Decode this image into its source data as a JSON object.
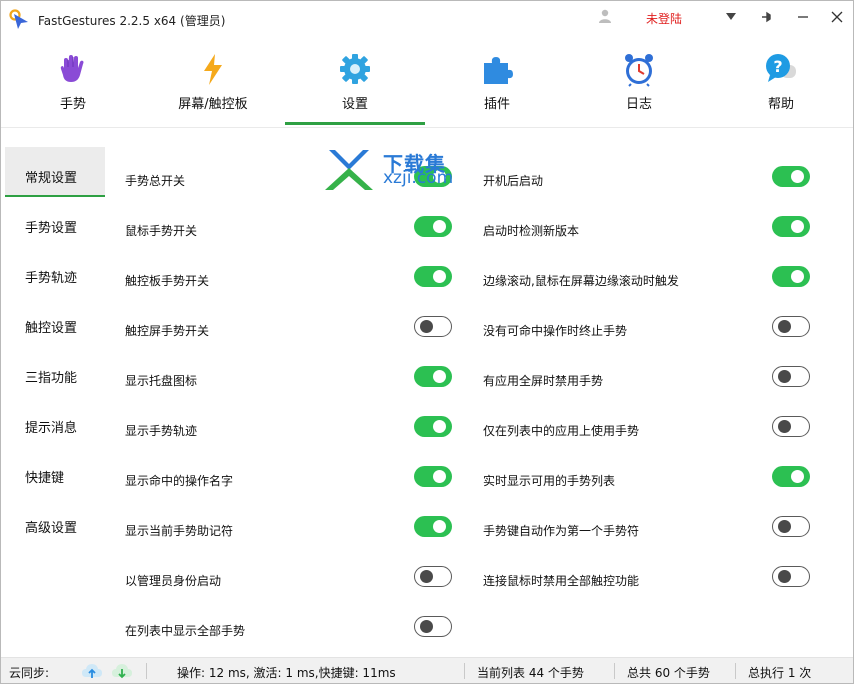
{
  "window": {
    "title": "FastGestures 2.2.5 x64  (管理员)",
    "login_status": "未登陆",
    "accent_color": "#2cc052",
    "login_color": "#e0201f"
  },
  "tabs": [
    {
      "label": "手势",
      "icon": "hand-icon",
      "active": false
    },
    {
      "label": "屏幕/触控板",
      "icon": "lightning-icon",
      "active": false
    },
    {
      "label": "设置",
      "icon": "gear-icon",
      "active": true
    },
    {
      "label": "插件",
      "icon": "puzzle-icon",
      "active": false
    },
    {
      "label": "日志",
      "icon": "alarm-clock-icon",
      "active": false
    },
    {
      "label": "帮助",
      "icon": "help-icon",
      "active": false
    }
  ],
  "sidenav": [
    {
      "label": "常规设置",
      "active": true
    },
    {
      "label": "手势设置",
      "active": false
    },
    {
      "label": "手势轨迹",
      "active": false
    },
    {
      "label": "触控设置",
      "active": false
    },
    {
      "label": "三指功能",
      "active": false
    },
    {
      "label": "提示消息",
      "active": false
    },
    {
      "label": "快捷键",
      "active": false
    },
    {
      "label": "高级设置",
      "active": false
    }
  ],
  "settings_left": [
    {
      "label": "手势总开关",
      "on": true
    },
    {
      "label": "鼠标手势开关",
      "on": true
    },
    {
      "label": "触控板手势开关",
      "on": true
    },
    {
      "label": "触控屏手势开关",
      "on": false
    },
    {
      "label": "显示托盘图标",
      "on": true
    },
    {
      "label": "显示手势轨迹",
      "on": true
    },
    {
      "label": "显示命中的操作名字",
      "on": true
    },
    {
      "label": "显示当前手势助记符",
      "on": true
    },
    {
      "label": "以管理员身份启动",
      "on": false
    },
    {
      "label": "在列表中显示全部手势",
      "on": false
    }
  ],
  "settings_right": [
    {
      "label": "开机后启动",
      "on": true
    },
    {
      "label": "启动时检测新版本",
      "on": true
    },
    {
      "label": "边缘滚动,鼠标在屏幕边缘滚动时触发",
      "on": true
    },
    {
      "label": "没有可命中操作时终止手势",
      "on": false
    },
    {
      "label": "有应用全屏时禁用手势",
      "on": false
    },
    {
      "label": "仅在列表中的应用上使用手势",
      "on": false
    },
    {
      "label": "实时显示可用的手势列表",
      "on": true
    },
    {
      "label": "手势键自动作为第一个手势符",
      "on": false
    },
    {
      "label": "连接鼠标时禁用全部触控功能",
      "on": false
    }
  ],
  "watermark": {
    "top": "下载集",
    "bottom": "xzji.com"
  },
  "statusbar": {
    "cloud_sync": "云同步:",
    "timing": "操作: 12 ms, 激活: 1 ms,快捷键: 11ms",
    "current_list": "当前列表 44 个手势",
    "total": "总共 60 个手势",
    "executed": "总执行 1 次"
  }
}
